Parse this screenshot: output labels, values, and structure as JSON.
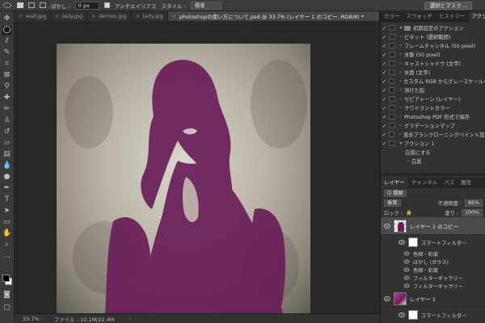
{
  "optionsbar": {
    "blur_label": "ぼかし :",
    "blur_value": "0 px",
    "antialias_label": "アンチエイリアス",
    "style_label": "スタイル :",
    "style_value": "標準",
    "select_mask_button": "選択とマスク..."
  },
  "tabs": [
    {
      "label": "wall.jpg"
    },
    {
      "label": "lady.jpg"
    },
    {
      "label": "demon.jpg"
    },
    {
      "label": "lady.jpg"
    },
    {
      "label": "photoshopの使い方について.psd @ 33.7% (レイヤー 1 のコピー, RGB/8) *",
      "active": true
    }
  ],
  "statusbar": {
    "zoom": "33.7%",
    "file_info": "ファイル : 10.1M/22.4M"
  },
  "panel_tabs_top": [
    "カラー",
    "スウォッチ",
    "ヒストリー",
    "アクション"
  ],
  "actions": [
    {
      "checked": true,
      "chevron": "▾",
      "folder": true,
      "label": "初期設定のアクション"
    },
    {
      "checked": true,
      "chevron": "›",
      "label": "ビネット (選択範囲)"
    },
    {
      "checked": true,
      "chevron": "›",
      "label": "フレームチャンネル (50 pixel)"
    },
    {
      "checked": true,
      "chevron": "›",
      "label": "木製 (50 pixel)"
    },
    {
      "checked": true,
      "chevron": "›",
      "label": "キャストシャドウ (文字)"
    },
    {
      "checked": true,
      "chevron": "›",
      "label": "水面 (文字)"
    },
    {
      "checked": true,
      "chevron": "›",
      "label": "カスタム RGB からグレースケールへ"
    },
    {
      "checked": true,
      "chevron": "›",
      "label": "溶けた鉛"
    },
    {
      "checked": true,
      "chevron": "›",
      "label": "セピアトーン (レイヤー)"
    },
    {
      "checked": true,
      "chevron": "›",
      "label": "クワドラントカラー"
    },
    {
      "checked": true,
      "chevron": "›",
      "label": "Photoshop PDF 形式で保存"
    },
    {
      "checked": true,
      "chevron": "›",
      "label": "グラデーションマップ"
    },
    {
      "checked": true,
      "chevron": "›",
      "label": "混合ブラシクローニングペイント設定"
    },
    {
      "checked": true,
      "chevron": "▾",
      "label": "アクション 1"
    },
    {
      "checked": false,
      "chevron": "",
      "label": "白黒にする",
      "indent": true
    },
    {
      "checked": false,
      "chevron": "›",
      "label": "白黒",
      "indent": true
    }
  ],
  "layers_tabs": [
    "レイヤー",
    "チャンネル",
    "パス",
    "属性"
  ],
  "layers": {
    "filter_kind": "Q 種類",
    "blend_mode": "乗算",
    "opacity_label": "不透明度 :",
    "opacity_value": "86%",
    "lock_label": "ロック :",
    "fill_label": "塗り :",
    "fill_value": "100%",
    "layer1_copy_name": "レイヤー 1 のコピー",
    "smart_filter_label": "スマートフィルター",
    "filters": [
      "色相・彩度",
      "ぼかし (ガウス)",
      "色相・彩度",
      "フィルターギャラリー",
      "フィルターギャラリー"
    ],
    "layer1_name": "レイヤー 1",
    "smart_filter_label_2": "スマートフィルター"
  },
  "colors": {
    "accent_purple": "#6a1e59",
    "ui_dark": "#2b2b2b",
    "panel_bg": "#323232"
  }
}
